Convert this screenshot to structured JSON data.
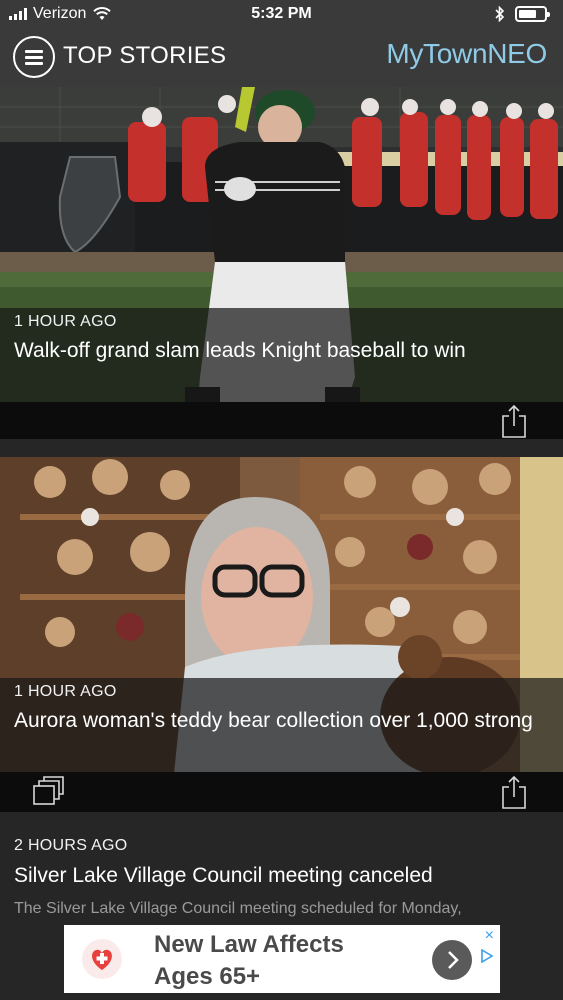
{
  "status_bar": {
    "carrier": "Verizon",
    "time": "5:32 PM",
    "battery_level": 0.7,
    "icons": [
      "signal-icon",
      "wifi-icon",
      "bluetooth-icon",
      "battery-icon"
    ]
  },
  "header": {
    "menu_icon": "hamburger-menu-icon",
    "title": "TOP STORIES",
    "brand": "MyTownNEO"
  },
  "stories": [
    {
      "time": "1 HOUR AGO",
      "headline": "Walk-off grand slam leads Knight baseball to win",
      "image": "baseball-batter-photo",
      "icons": [
        "share-icon"
      ]
    },
    {
      "time": "1 HOUR AGO",
      "headline": "Aurora woman's teddy bear collection over 1,000 strong",
      "image": "teddy-bear-collector-photo",
      "icons": [
        "gallery-icon",
        "share-icon"
      ]
    },
    {
      "time": "2 HOURS AGO",
      "headline": "Silver Lake Village Council meeting canceled",
      "summary": "The Silver Lake Village Council meeting scheduled for Monday,"
    }
  ],
  "ad": {
    "text": "New Law Affects Ages 65+",
    "line1": "New Law Affects",
    "line2": "Ages 65+",
    "close": "×",
    "icons": [
      "heart-icon",
      "chevron-right-icon",
      "ad-choices-icon"
    ],
    "colors": {
      "heart": "#e8403c",
      "ad_link": "#3aa0e8"
    }
  },
  "colors": {
    "header_bg": "#3a3a3a",
    "brand": "#8fcbe6",
    "page_bg": "#262626"
  }
}
